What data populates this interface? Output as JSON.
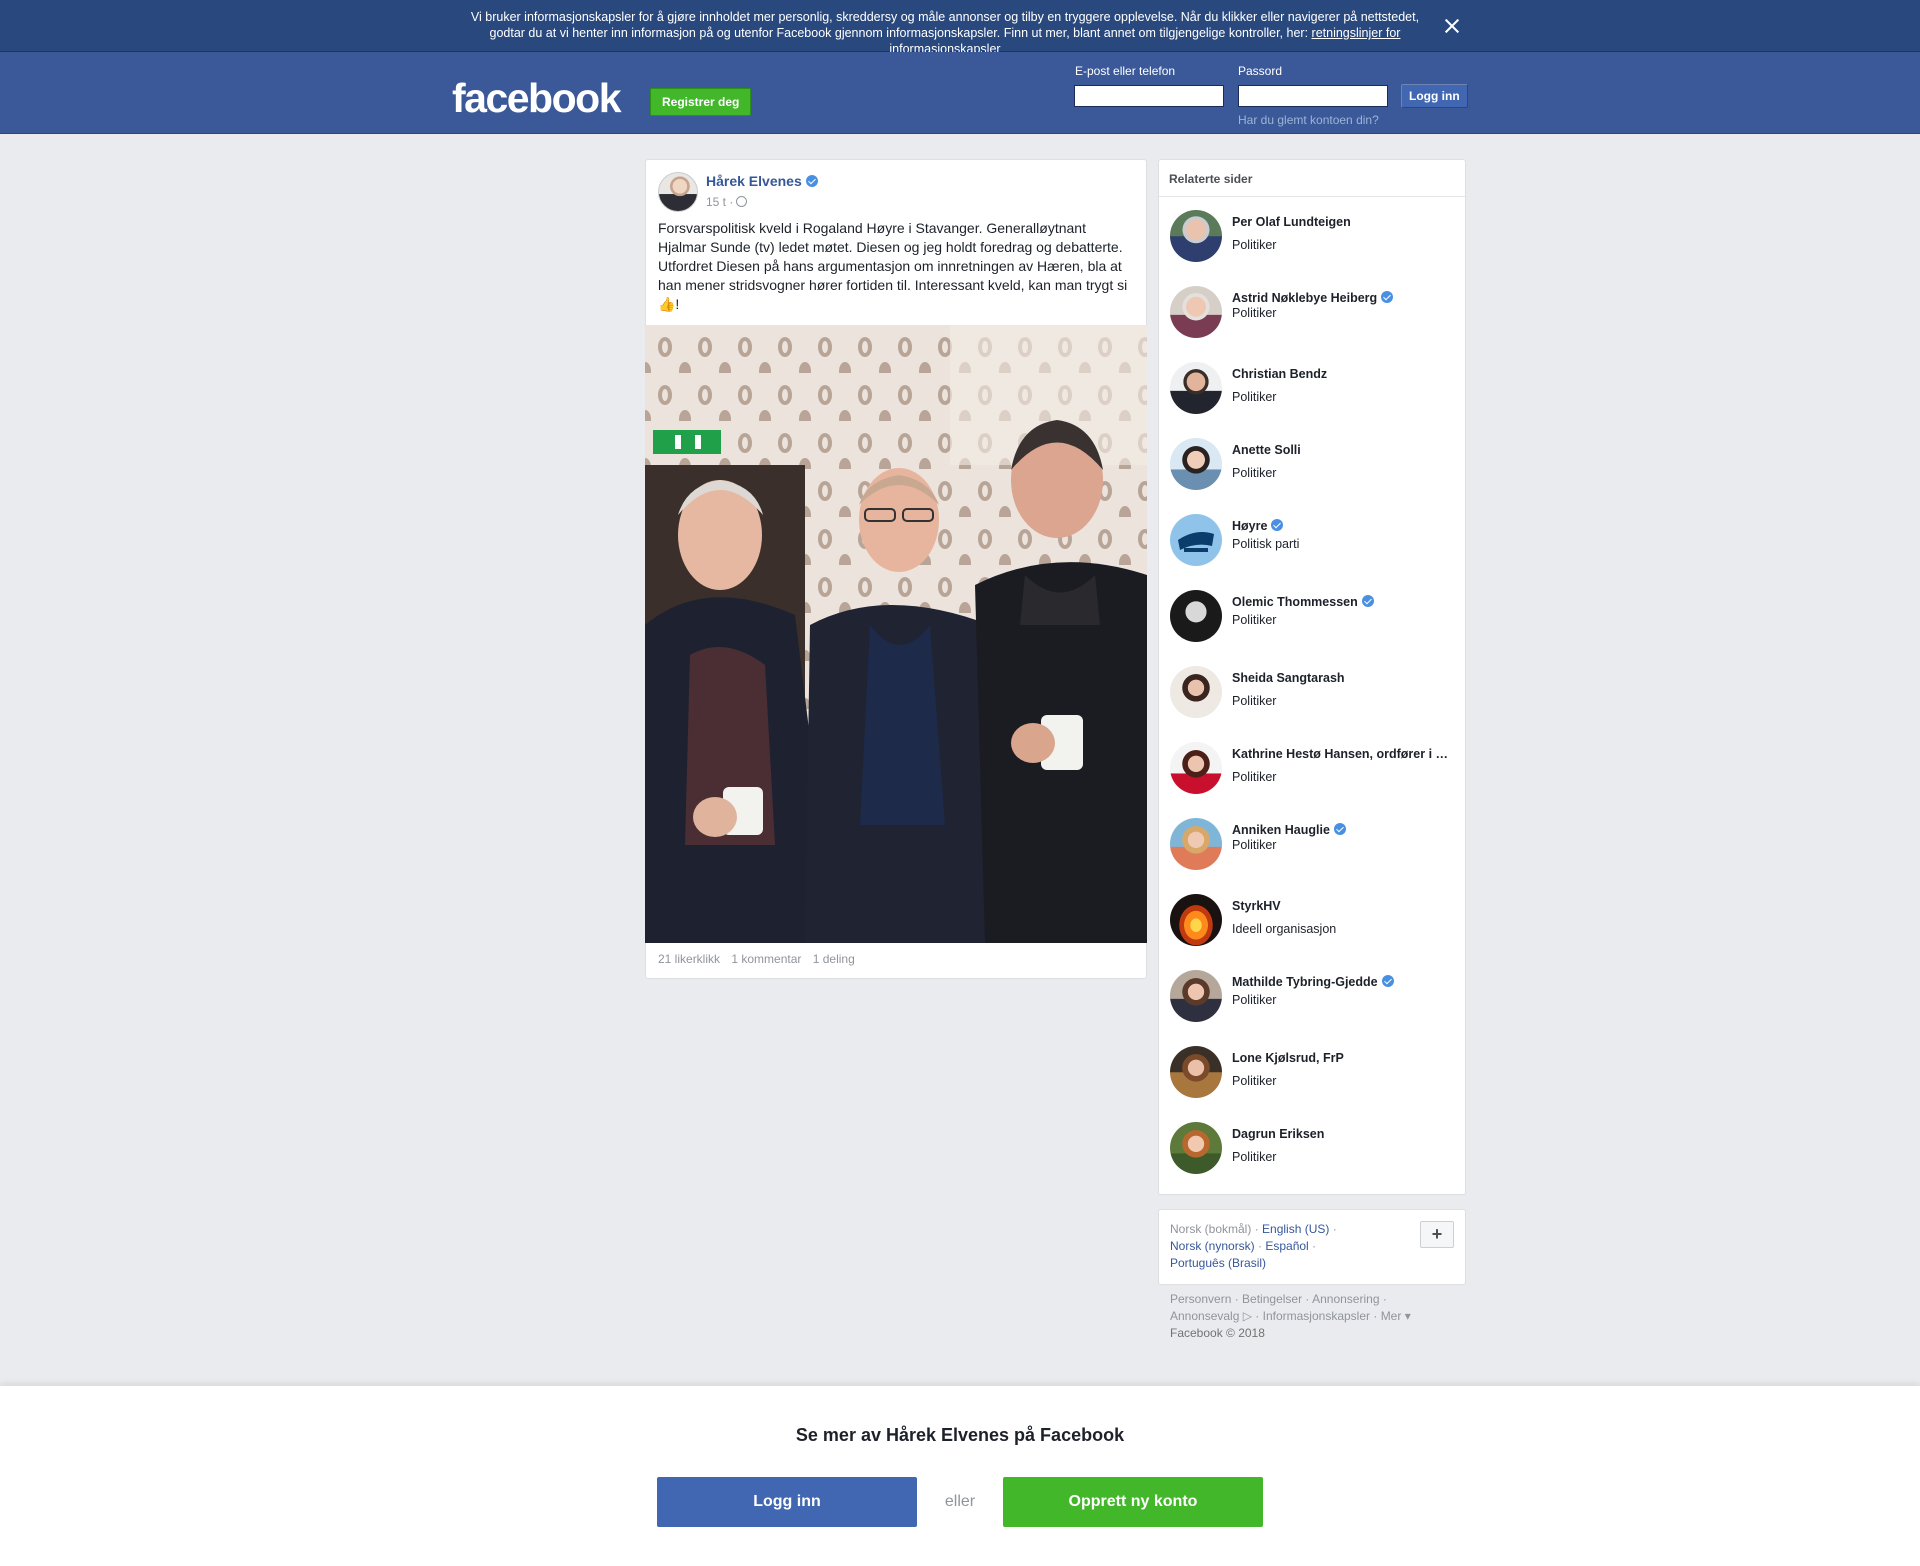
{
  "cookie_banner": {
    "text": "Vi bruker informasjonskapsler for å gjøre innholdet mer personlig, skreddersy og måle annonser og tilby en tryggere opplevelse. Når du klikker eller navigerer på nettstedet, godtar du at vi henter inn informasjon på og utenfor Facebook gjennom informasjonskapsler. Finn ut mer, blant annet om tilgjengelige kontroller, her: ",
    "link_text": "retningslinjer for informasjonskapsler"
  },
  "header": {
    "logo": "facebook",
    "register_label": "Registrer deg",
    "email_label": "E-post eller telefon",
    "password_label": "Passord",
    "login_label": "Logg inn",
    "forgot_label": "Har du glemt kontoen din?"
  },
  "post": {
    "author": "Hårek Elvenes",
    "time": "15 t ·",
    "text": "Forsvarspolitisk kveld i Rogaland Høyre i Stavanger. Generalløytnant Hjalmar Sunde (tv) ledet møtet. Diesen og jeg holdt foredrag og debatterte. Utfordret Diesen på hans argumentasjon om innretningen av Hæren, bla at han mener stridsvogner hører fortiden til. Interessant kveld, kan man trygt si 👍!",
    "likes": "21 likerklikk",
    "comments": "1 kommentar",
    "shares": "1 deling"
  },
  "related": {
    "title": "Relaterte sider",
    "items": [
      {
        "name": "Per Olaf Lundteigen",
        "category": "Politiker",
        "verified": false
      },
      {
        "name": "Astrid Nøklebye Heiberg",
        "category": "Politiker",
        "verified": true
      },
      {
        "name": "Christian Bendz",
        "category": "Politiker",
        "verified": false
      },
      {
        "name": "Anette Solli",
        "category": "Politiker",
        "verified": false
      },
      {
        "name": "Høyre",
        "category": "Politisk parti",
        "verified": true
      },
      {
        "name": "Olemic Thommessen",
        "category": "Politiker",
        "verified": true
      },
      {
        "name": "Sheida Sangtarash",
        "category": "Politiker",
        "verified": false
      },
      {
        "name": "Kathrine Hestø Hansen, ordfører i Elverum kommune",
        "category": "Politiker",
        "verified": false
      },
      {
        "name": "Anniken Hauglie",
        "category": "Politiker",
        "verified": true
      },
      {
        "name": "StyrkHV",
        "category": "Ideell organisasjon",
        "verified": false
      },
      {
        "name": "Mathilde Tybring-Gjedde",
        "category": "Politiker",
        "verified": true
      },
      {
        "name": "Lone Kjølsrud, FrP",
        "category": "Politiker",
        "verified": false
      },
      {
        "name": "Dagrun Eriksen",
        "category": "Politiker",
        "verified": false
      }
    ]
  },
  "languages": {
    "current": "Norsk (bokmål)",
    "english": "English (US)",
    "nynorsk": "Norsk (nynorsk)",
    "spanish": "Español",
    "portuguese": "Português (Brasil)",
    "add_label": "+"
  },
  "footer": {
    "privacy": "Personvern",
    "terms": "Betingelser",
    "ads": "Annonsering",
    "ad_choices": "Annonsevalg",
    "cookies": "Informasjonskapsler",
    "more": "Mer",
    "copyright": "Facebook © 2018"
  },
  "bottom": {
    "title": "Se mer av Hårek Elvenes på Facebook",
    "login_label": "Logg inn",
    "or_label": "eller",
    "create_label": "Opprett ny konto"
  },
  "colors": {
    "brand_blue": "#3b5998",
    "cookie_bar": "#29487d",
    "green": "#42b72a",
    "link": "#365899"
  }
}
